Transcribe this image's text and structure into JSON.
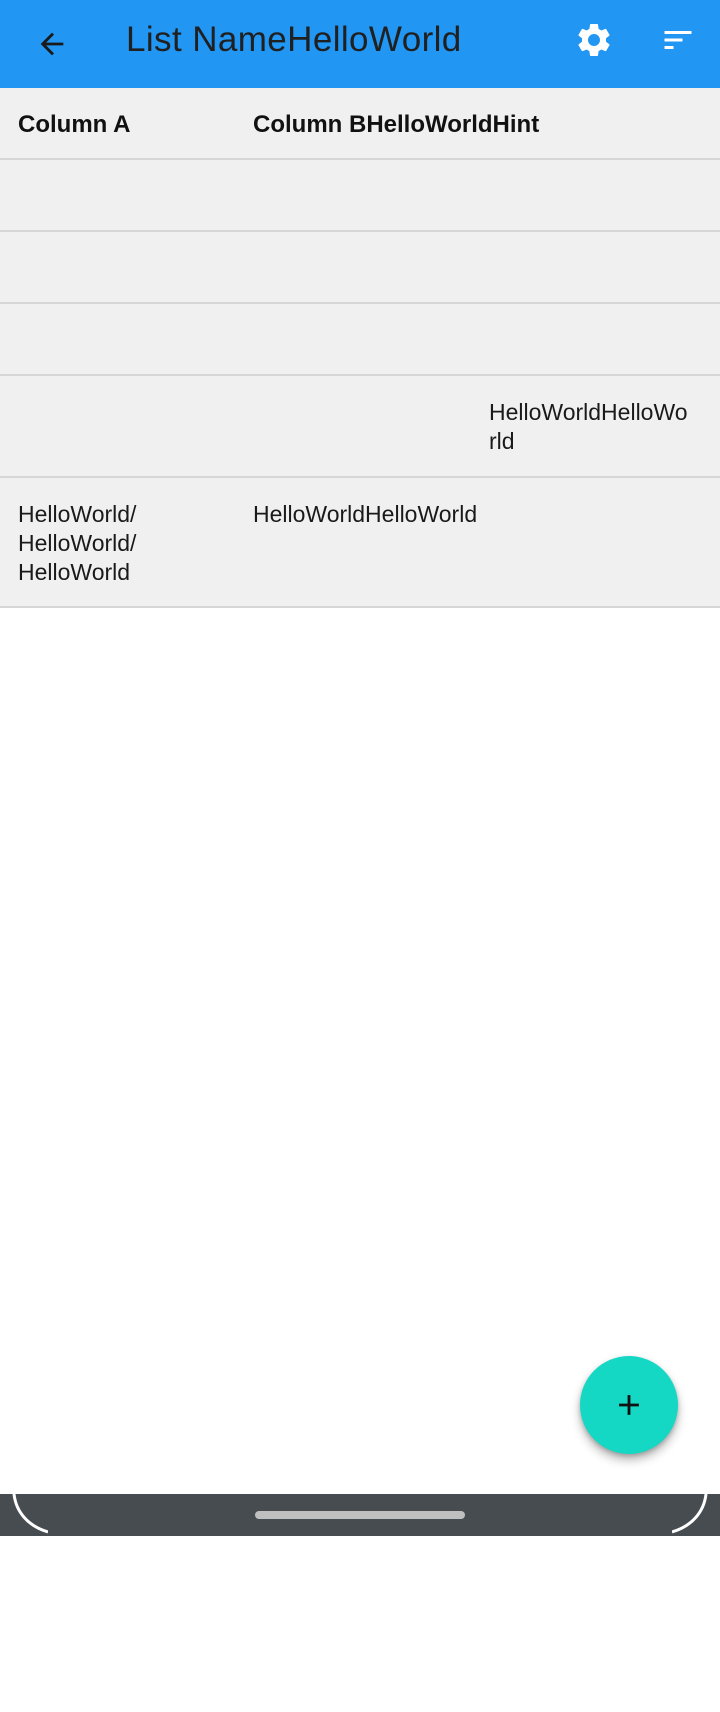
{
  "app_bar": {
    "title": "List NameHelloWorld",
    "background_color": "#2196F3",
    "back_icon": "arrow-back-icon",
    "settings_icon": "gear-icon",
    "sort_icon": "sort-icon"
  },
  "table": {
    "headers": [
      "Column A",
      "Column BHelloWorldHint",
      ""
    ],
    "rows": [
      [
        "",
        "",
        ""
      ],
      [
        "",
        "",
        ""
      ],
      [
        "",
        "",
        ""
      ],
      [
        "",
        "",
        "HelloWorldHelloWorld"
      ],
      [
        "HelloWorld/\nHelloWorld/\nHelloWorld",
        "HelloWorldHelloWorld",
        ""
      ]
    ]
  },
  "fab": {
    "icon": "plus-icon",
    "color": "#14D8C4"
  },
  "nav_bar": {
    "color": "#474c50"
  }
}
